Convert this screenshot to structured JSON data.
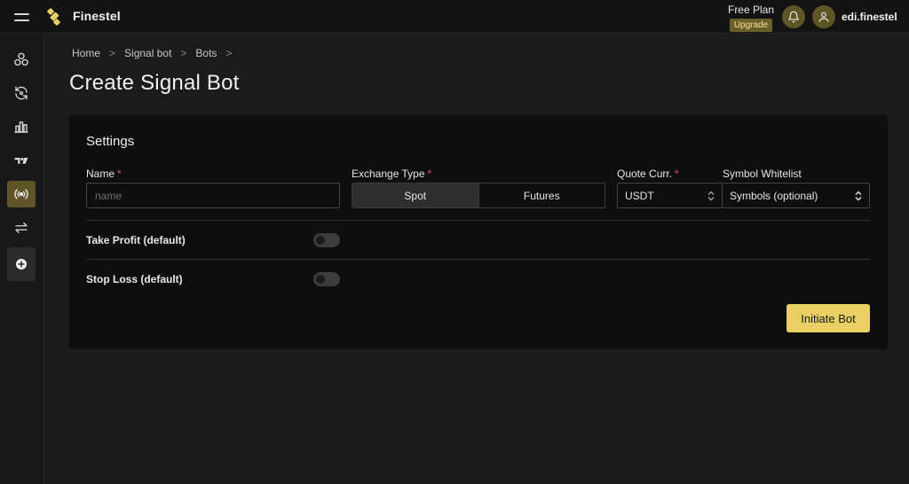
{
  "app": {
    "brand": "Finestel",
    "plan_name": "Free Plan",
    "upgrade_label": "Upgrade",
    "username": "edi.finestel",
    "accent": "#e9cf64",
    "accent_dark": "#5e5526"
  },
  "icons": {
    "menu": "hamburger-icon",
    "logo": "finestel-logo",
    "notifications": "bell-icon",
    "user": "user-icon",
    "sidebar": [
      "circles-icon",
      "refresh-icon",
      "bar-chart-icon",
      "tradingview-icon",
      "signal-broadcast-icon",
      "swap-arrows-icon",
      "plus-circle-icon"
    ]
  },
  "sidebar": {
    "active_index": 4
  },
  "breadcrumb": {
    "items": [
      "Home",
      "Signal bot",
      "Bots"
    ],
    "separator": ">"
  },
  "page": {
    "title": "Create Signal Bot"
  },
  "form": {
    "section_title": "Settings",
    "name": {
      "label": "Name",
      "required_mark": "*",
      "placeholder": "name",
      "value": ""
    },
    "exchange_type": {
      "label": "Exchange Type",
      "required_mark": "*",
      "options": [
        "Spot",
        "Futures"
      ],
      "selected": "Spot"
    },
    "quote_currency": {
      "label": "Quote Curr.",
      "required_mark": "*",
      "value": "USDT"
    },
    "symbol_whitelist": {
      "label": "Symbol Whitelist",
      "value": "Symbols (optional)"
    },
    "take_profit": {
      "label": "Take Profit (default)",
      "enabled": false
    },
    "stop_loss": {
      "label": "Stop Loss (default)",
      "enabled": false
    },
    "submit_label": "Initiate Bot"
  }
}
